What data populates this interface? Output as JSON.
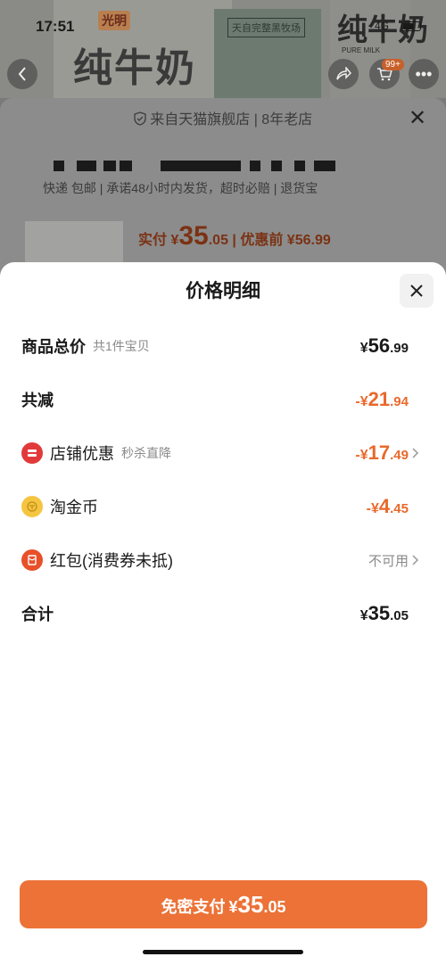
{
  "status_bar": {
    "time": "17:51",
    "network": "4G"
  },
  "background": {
    "hero": {
      "brand": "光明",
      "title_left": "纯牛奶",
      "title_middle": "天自完整黑牧场",
      "title_right": "纯牛奶",
      "title_right_sub": "PURE MILK"
    },
    "badge": "99+",
    "shop_line": "来自天猫旗舰店 | 8年老店",
    "delivery_line": "快递 包邮 | 承诺48小时内发货，超时必赔 | 退货宝",
    "pay_label": "实付 ¥",
    "pay_int": "35",
    "pay_dec": ".05",
    "pay_before": " | 优惠前 ¥56.99"
  },
  "sheet": {
    "title": "价格明细",
    "rows": {
      "total": {
        "label": "商品总价",
        "sub": "共1件宝贝",
        "prefix": "¥",
        "int": "56",
        "dec": ".99"
      },
      "reduced": {
        "label": "共减",
        "prefix": "-¥",
        "int": "21",
        "dec": ".94"
      },
      "shop_discount": {
        "label": "店铺优惠",
        "sub": "秒杀直降",
        "prefix": "-¥",
        "int": "17",
        "dec": ".49"
      },
      "gold_coin": {
        "label": "淘金币",
        "prefix": "-¥",
        "int": "4",
        "dec": ".45"
      },
      "red_packet": {
        "label": "红包(消费券未抵)",
        "value": "不可用"
      },
      "sum": {
        "label": "合计",
        "prefix": "¥",
        "int": "35",
        "dec": ".05"
      }
    },
    "pay_button": {
      "label": "免密支付",
      "prefix": "¥",
      "int": "35",
      "dec": ".05"
    }
  },
  "colors": {
    "accent": "#ec7237",
    "discount": "#e8692c"
  }
}
